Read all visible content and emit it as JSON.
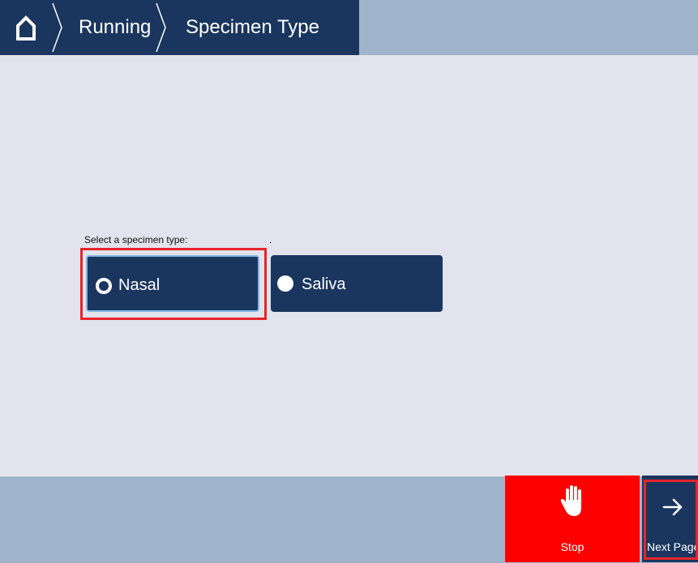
{
  "header": {
    "home_icon": "home-icon",
    "breadcrumbs": [
      "Running",
      "Specimen Type"
    ]
  },
  "main": {
    "prompt": "Select a specimen type:",
    "stray_mark": ".",
    "options": [
      {
        "label": "Nasal",
        "selected": true,
        "highlighted": true
      },
      {
        "label": "Saliva",
        "selected": false,
        "highlighted": false
      }
    ]
  },
  "footer": {
    "stop_label": "Stop",
    "stop_icon": "hand-stop-icon",
    "next_label": "Next Page",
    "next_icon": "arrow-right-icon",
    "next_highlighted": true
  },
  "colors": {
    "navy": "#1a365f",
    "slate": "#9fb4ca",
    "background": "#e2e3ec",
    "stop_red": "#ff0000",
    "highlight_red": "#e8242a"
  }
}
